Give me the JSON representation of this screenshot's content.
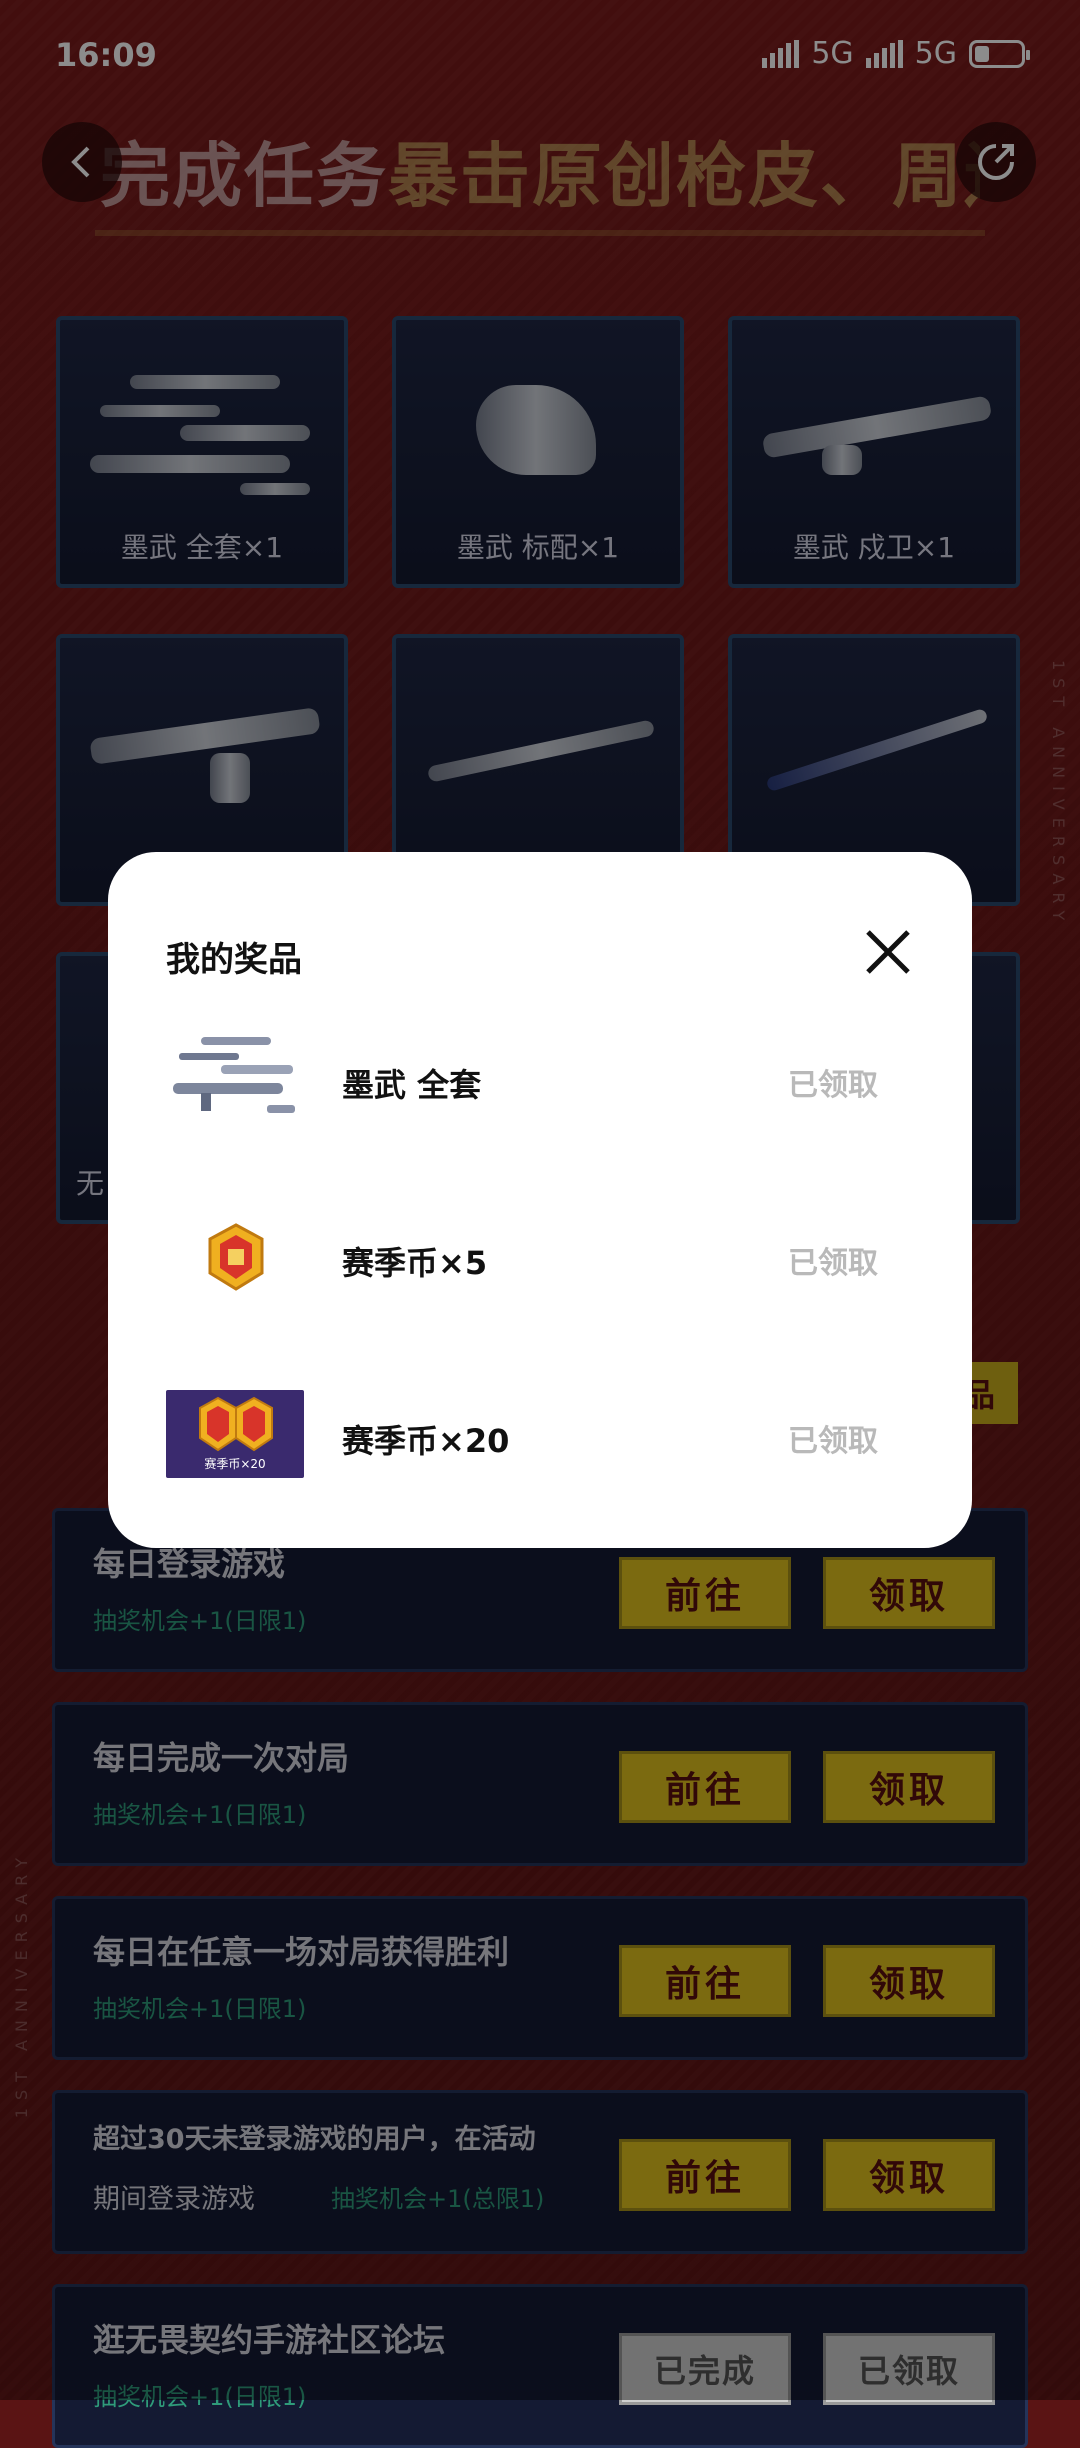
{
  "status_bar": {
    "time": "16:09",
    "net1": "5G",
    "net2": "5G"
  },
  "header": {
    "title_white": "完成任务",
    "title_yellow": "暴击原创枪皮、周边"
  },
  "prize_grid": [
    {
      "label": "墨武 全套×1"
    },
    {
      "label": "墨武 标配×1"
    },
    {
      "label": "墨武 戍卫×1"
    }
  ],
  "partial_label": "无",
  "partial_button": "品",
  "tasks": [
    {
      "name": "每日登录游戏",
      "sub": "抽奖机会+1(日限1)",
      "go": "前往",
      "get": "领取"
    },
    {
      "name": "每日完成一次对局",
      "sub": "抽奖机会+1(日限1)",
      "go": "前往",
      "get": "领取"
    },
    {
      "name": "每日在任意一场对局获得胜利",
      "sub": "抽奖机会+1(日限1)",
      "go": "前往",
      "get": "领取"
    },
    {
      "name_line1": "超过30天未登录游戏的用户，在活动",
      "name_line2": "期间登录游戏",
      "sub": "抽奖机会+1(总限1)",
      "go": "前往",
      "get": "领取"
    },
    {
      "name": "逛无畏契约手游社区论坛",
      "sub": "抽奖机会+1(日限1)",
      "go": "已完成",
      "get": "已领取"
    }
  ],
  "side_text": "1ST ANNIVERSARY",
  "modal": {
    "title": "我的奖品",
    "items": [
      {
        "name": "墨武  全套",
        "status": "已领取"
      },
      {
        "name": "赛季币×5",
        "status": "已领取"
      },
      {
        "name": "赛季币×20",
        "status": "已领取",
        "thumb_caption": "赛季币×20"
      }
    ]
  },
  "colors": {
    "accent_yellow": "#e0c21e",
    "modal_bg": "#ffffff",
    "claimed_grey": "#b9b9b9"
  },
  "icons": {
    "back": "chevron-left-icon",
    "share": "share-icon",
    "close": "close-icon"
  }
}
